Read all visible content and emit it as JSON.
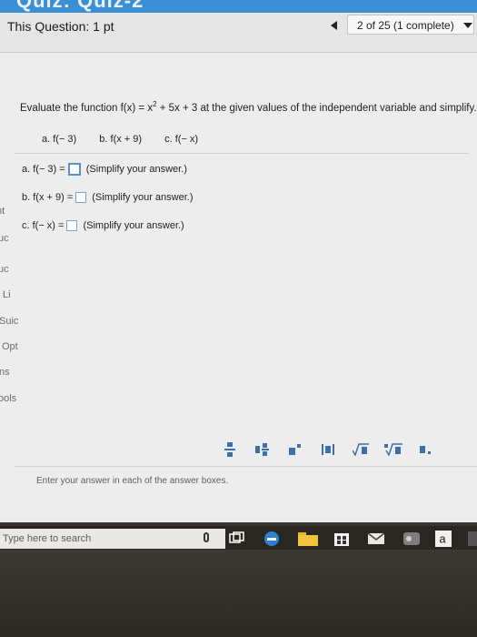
{
  "header": {
    "title": "Quiz: Quiz-2"
  },
  "question_bar": {
    "label": "This Question: 1 pt",
    "counter": "2 of 25 (1 complete)"
  },
  "sidebar": {
    "fragments": [
      "nt",
      "uc",
      "uc",
      "Li",
      "Suic",
      "Opt",
      "ns",
      "ools"
    ]
  },
  "question": {
    "prompt_prefix": "Evaluate the function f(x) = x",
    "prompt_exponent": "2",
    "prompt_suffix": " + 5x + 3 at the given values of the independent variable and simplify.",
    "parts": [
      "a.  f(− 3)",
      "b.  f(x + 9)",
      "c.  f(− x)"
    ]
  },
  "answers": [
    {
      "label": "a.  f(− 3) =",
      "hint": "(Simplify your answer.)"
    },
    {
      "label": "b.  f(x + 9) =",
      "hint": "(Simplify your answer.)"
    },
    {
      "label": "c.  f(− x) =",
      "hint": "(Simplify your answer.)"
    }
  ],
  "toolbar": {
    "tools": [
      "fraction-icon",
      "mixed-number-icon",
      "exponent-icon",
      "absolute-value-icon",
      "sqrt-icon",
      "nth-root-icon",
      "decimal-icon"
    ]
  },
  "status": {
    "text": "Enter your answer in each of the answer boxes."
  },
  "taskbar": {
    "search_placeholder": "Type here to search",
    "icon_names": [
      "mic-icon",
      "task-view-icon",
      "edge-icon",
      "file-explorer-icon",
      "store-icon",
      "paint-icon",
      "amazon-icon"
    ]
  },
  "colors": {
    "header_blue": "#3b8fd4",
    "screen_bg": "#ecedec",
    "answer_box_border": "#7ca5cf"
  }
}
